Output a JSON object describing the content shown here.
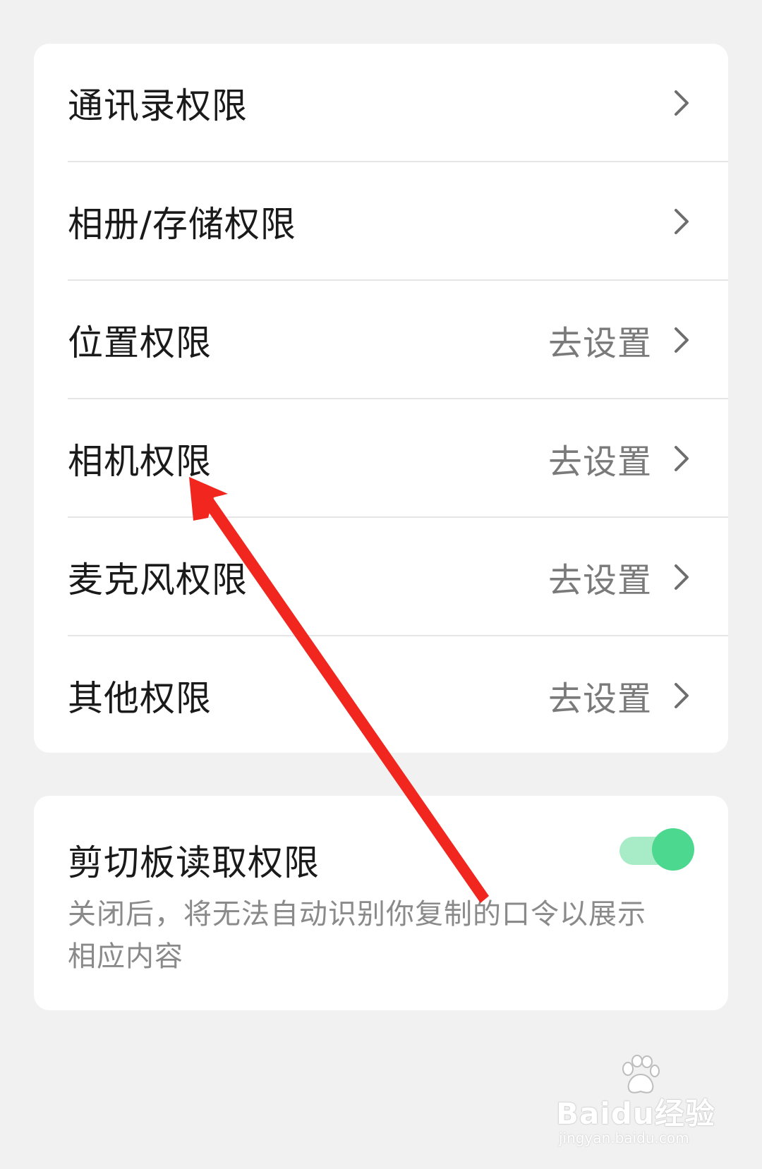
{
  "permissions": {
    "items": [
      {
        "label": "通讯录权限",
        "action": ""
      },
      {
        "label": "相册/存储权限",
        "action": ""
      },
      {
        "label": "位置权限",
        "action": "去设置"
      },
      {
        "label": "相机权限",
        "action": "去设置"
      },
      {
        "label": "麦克风权限",
        "action": "去设置"
      },
      {
        "label": "其他权限",
        "action": "去设置"
      }
    ]
  },
  "clipboard": {
    "title": "剪切板读取权限",
    "description": "关闭后，将无法自动识别你复制的口令以展示相应内容",
    "enabled": true
  },
  "watermark": {
    "brand": "Baidu经验",
    "url": "jingyan.baidu.com"
  },
  "colors": {
    "background": "#f1f1f1",
    "card": "#ffffff",
    "toggle_on": "#4cd88e",
    "annotation_arrow": "#f0261f"
  },
  "icons": {
    "row_chevron": "chevron-right-icon",
    "annotation": "red-arrow"
  }
}
